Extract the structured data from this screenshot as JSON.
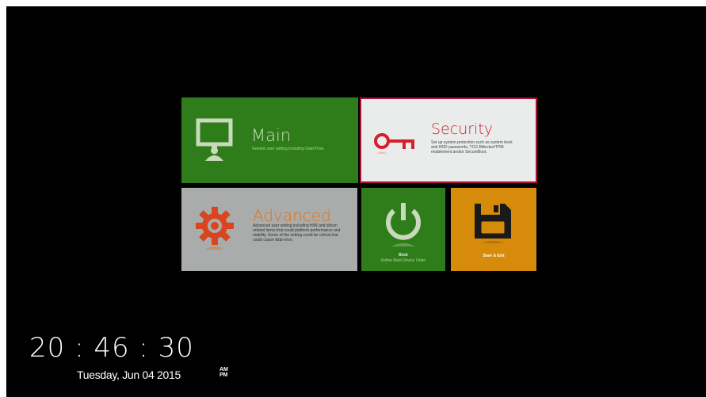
{
  "tiles": {
    "main": {
      "title": "Main",
      "description": "Generic user setting including Date/Time.",
      "icon": "monitor-user-icon",
      "color": "#2e7d1a"
    },
    "security": {
      "title": "Security",
      "description": "Set up system protection such as system level and HDD passwords, TCG Bitlocker/TPM enablement and/or SecureBoot.",
      "icon": "key-icon",
      "color": "#e9ecea",
      "accent": "#d4202e",
      "selected": true
    },
    "advanced": {
      "title": "Advanced",
      "description": "Advanced user setting including H/W and silicon related items that could platform performance and stability. Some of the setting could be critical that could cause fatal error.",
      "icon": "gear-icon",
      "color": "#a9acab",
      "accent": "#e0731d"
    },
    "boot": {
      "title": "Boot",
      "description": "Define Boot Device Order",
      "icon": "power-icon",
      "color": "#2e7d1a"
    },
    "save_exit": {
      "title": "Save & Exit",
      "icon": "floppy-disk-icon",
      "color": "#d68c0a"
    }
  },
  "clock": {
    "time": "20 : 46 : 30",
    "date": "Tuesday, Jun 04 2015",
    "am": "AM",
    "pm": "PM"
  }
}
